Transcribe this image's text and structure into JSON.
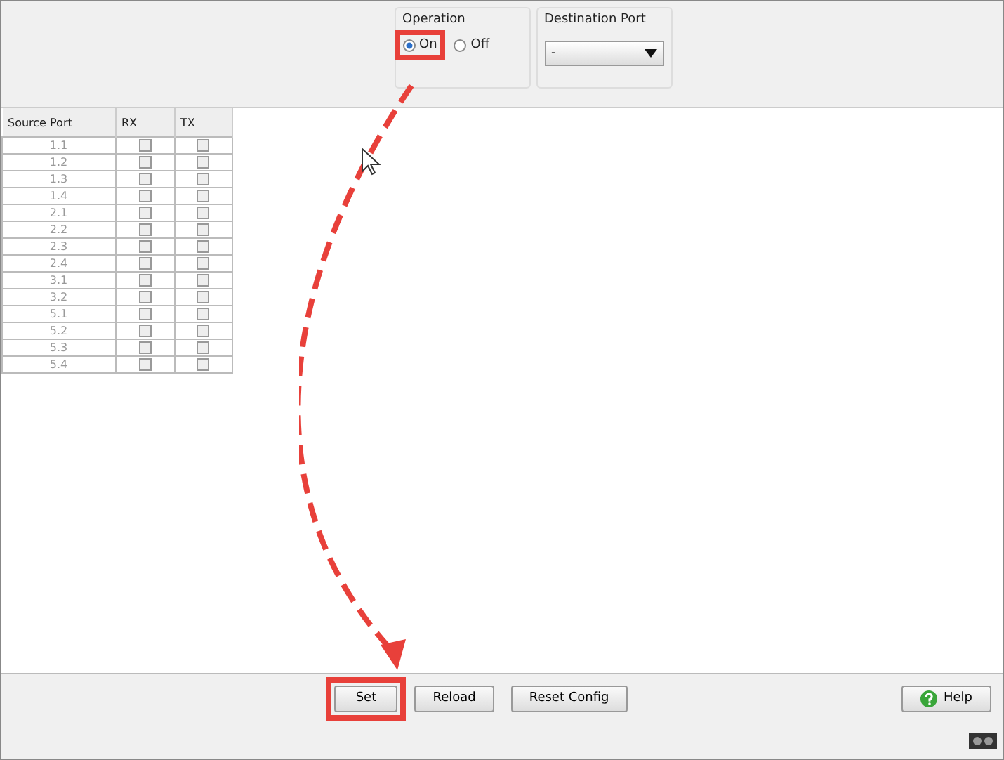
{
  "operation": {
    "label": "Operation",
    "options": [
      {
        "label": "On",
        "selected": true,
        "highlighted": true
      },
      {
        "label": "Off",
        "selected": false,
        "highlighted": false
      }
    ]
  },
  "destination_port": {
    "label": "Destination Port",
    "value": "-"
  },
  "table": {
    "columns": [
      "Source Port",
      "RX",
      "TX"
    ],
    "rows": [
      {
        "port": "1.1",
        "rx": false,
        "tx": false
      },
      {
        "port": "1.2",
        "rx": false,
        "tx": false
      },
      {
        "port": "1.3",
        "rx": false,
        "tx": false
      },
      {
        "port": "1.4",
        "rx": false,
        "tx": false
      },
      {
        "port": "2.1",
        "rx": false,
        "tx": false
      },
      {
        "port": "2.2",
        "rx": false,
        "tx": false
      },
      {
        "port": "2.3",
        "rx": false,
        "tx": false
      },
      {
        "port": "2.4",
        "rx": false,
        "tx": false
      },
      {
        "port": "3.1",
        "rx": false,
        "tx": false
      },
      {
        "port": "3.2",
        "rx": false,
        "tx": false
      },
      {
        "port": "5.1",
        "rx": false,
        "tx": false
      },
      {
        "port": "5.2",
        "rx": false,
        "tx": false
      },
      {
        "port": "5.3",
        "rx": false,
        "tx": false
      },
      {
        "port": "5.4",
        "rx": false,
        "tx": false
      }
    ]
  },
  "buttons": [
    {
      "label": "Set",
      "highlighted": true
    },
    {
      "label": "Reload",
      "highlighted": false
    },
    {
      "label": "Reset Config",
      "highlighted": false
    }
  ],
  "help_button": "Help"
}
